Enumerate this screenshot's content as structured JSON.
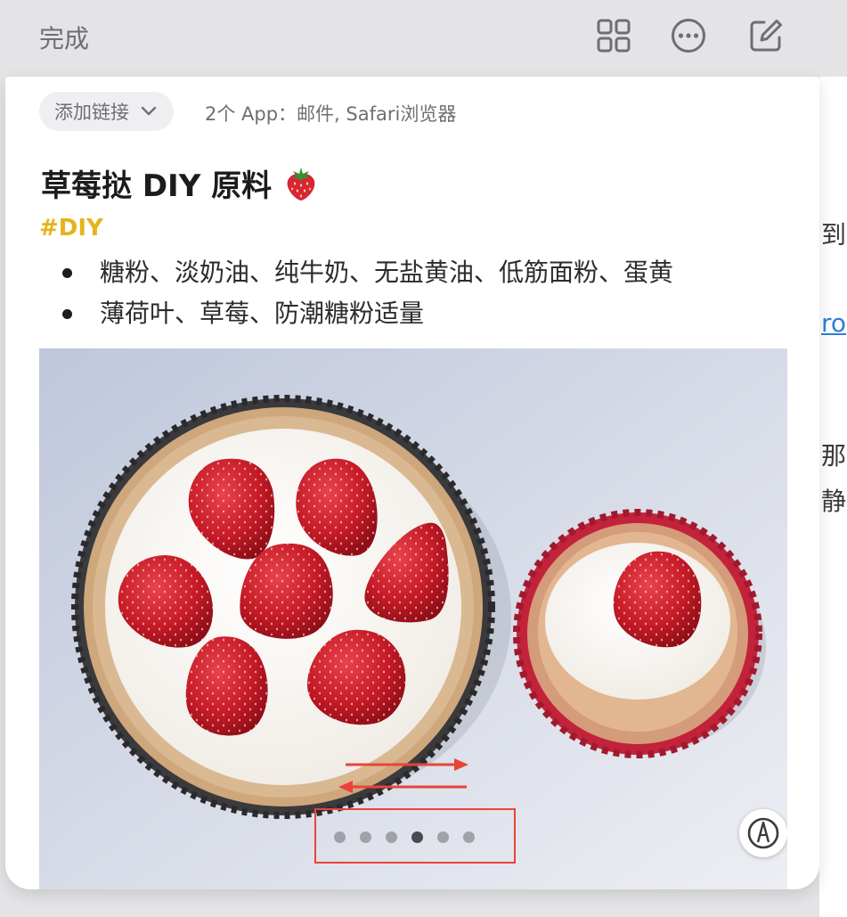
{
  "topbar": {
    "done_label": "完成",
    "icons": [
      "grid-icon",
      "ellipsis-circle-icon",
      "compose-icon"
    ]
  },
  "background_note": {
    "fragments": [
      "到",
      "ro",
      "那",
      "静"
    ]
  },
  "share_sheet": {
    "add_link_label": "添加链接",
    "apps_info": "2个 App：邮件, Safari浏览器"
  },
  "note": {
    "title": "草莓挞 DIY 原料",
    "title_emoji": "strawberry-emoji",
    "tag": "#DIY",
    "bullets": [
      "糖粉、淡奶油、纯牛奶、无盐黄油、低筋面粉、蛋黄",
      "薄荷叶、草莓、防潮糖粉适量"
    ]
  },
  "attachment": {
    "description": "strawberry-tart-photo",
    "page_count": 6,
    "current_page_index": 3,
    "markup_icon": "markup-pen-icon"
  },
  "colors": {
    "tag_yellow": "#e6b31a",
    "annotation_red": "#e8443a",
    "link_blue": "#2f7fd6"
  }
}
